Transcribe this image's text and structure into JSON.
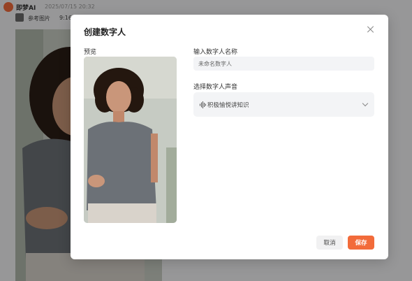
{
  "chat": {
    "app_name": "即梦AI",
    "timestamp": "2025/07/15 20:32",
    "reference_label": "参考图片",
    "reference_time": "9:16"
  },
  "dialog": {
    "title": "创建数字人",
    "preview_label": "预览",
    "name_label": "输入数字人名称",
    "name_placeholder": "未命名数字人",
    "voice_label": "选择数字人声音",
    "voice_value": "积极愉悦讲知识",
    "cancel_label": "取消",
    "save_label": "保存"
  },
  "colors": {
    "accent": "#f26b3a",
    "field_bg": "#f3f4f6"
  }
}
